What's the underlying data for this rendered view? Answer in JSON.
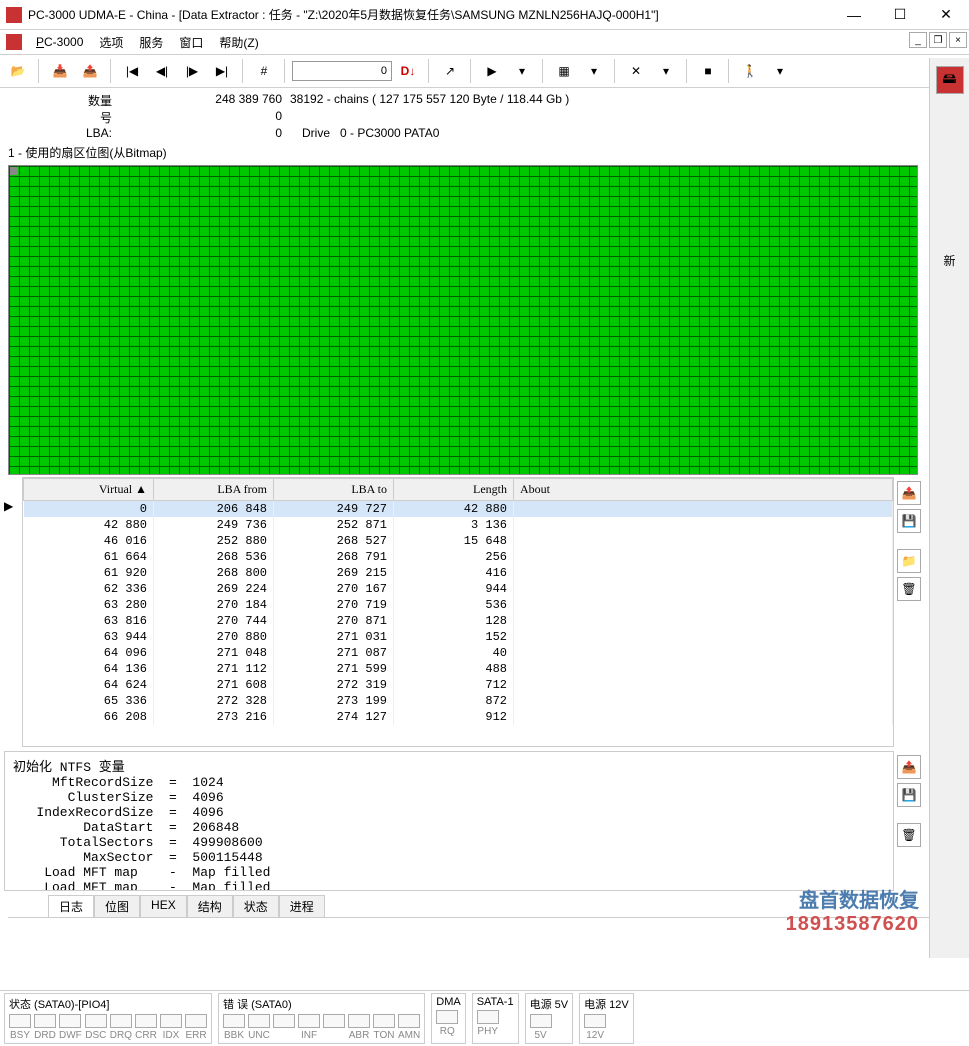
{
  "window": {
    "title": "PC-3000 UDMA-E - China - [Data Extractor : 任务 - \"Z:\\2020年5月数据恢复任务\\SAMSUNG MZNLN256HAJQ-000H1\"]"
  },
  "menu": {
    "app": "PC-3000",
    "items": [
      "选项",
      "服务",
      "窗口",
      "帮助(Z)"
    ]
  },
  "toolbar": {
    "input_value": "0",
    "input_marker": "D↓"
  },
  "info": {
    "qty_label": "数量",
    "qty_value": "248 389 760",
    "chains": "38192 - chains   ( 127 175 557 120 Byte /  118.44 Gb )",
    "num_label": "号",
    "num_value": "0",
    "lba_label": "LBA:",
    "lba_value": "0",
    "drive_label": "Drive",
    "drive_value": "0 - PC3000 PATA0"
  },
  "bitmap": {
    "title": "1 - 使用的扇区位图(从Bitmap)"
  },
  "table": {
    "headers": [
      "Virtual   ▲",
      "LBA from",
      "LBA to",
      "Length",
      "About"
    ],
    "rows": [
      {
        "virtual": "0",
        "from": "206 848",
        "to": "249 727",
        "len": "42 880",
        "sel": true
      },
      {
        "virtual": "42 880",
        "from": "249 736",
        "to": "252 871",
        "len": "3 136"
      },
      {
        "virtual": "46 016",
        "from": "252 880",
        "to": "268 527",
        "len": "15 648"
      },
      {
        "virtual": "61 664",
        "from": "268 536",
        "to": "268 791",
        "len": "256"
      },
      {
        "virtual": "61 920",
        "from": "268 800",
        "to": "269 215",
        "len": "416"
      },
      {
        "virtual": "62 336",
        "from": "269 224",
        "to": "270 167",
        "len": "944"
      },
      {
        "virtual": "63 280",
        "from": "270 184",
        "to": "270 719",
        "len": "536"
      },
      {
        "virtual": "63 816",
        "from": "270 744",
        "to": "270 871",
        "len": "128"
      },
      {
        "virtual": "63 944",
        "from": "270 880",
        "to": "271 031",
        "len": "152"
      },
      {
        "virtual": "64 096",
        "from": "271 048",
        "to": "271 087",
        "len": "40"
      },
      {
        "virtual": "64 136",
        "from": "271 112",
        "to": "271 599",
        "len": "488"
      },
      {
        "virtual": "64 624",
        "from": "271 608",
        "to": "272 319",
        "len": "712"
      },
      {
        "virtual": "65 336",
        "from": "272 328",
        "to": "273 199",
        "len": "872"
      },
      {
        "virtual": "66 208",
        "from": "273 216",
        "to": "274 127",
        "len": "912"
      }
    ]
  },
  "log": {
    "text": "初始化 NTFS 变量\n     MftRecordSize  =  1024\n       ClusterSize  =  4096\n   IndexRecordSize  =  4096\n         DataStart  =  206848\n      TotalSectors  =  499908600\n         MaxSector  =  500115448\n    Load MFT map    -  Map filled\n    Load MFT map    -  Map filled"
  },
  "tabs": {
    "items": [
      "日志",
      "位图",
      "HEX",
      "结构",
      "状态",
      "进程"
    ],
    "active": 0
  },
  "status": {
    "group1": {
      "title": "状态 (SATA0)-[PIO4]",
      "leds": [
        "BSY",
        "DRD",
        "DWF",
        "DSC",
        "DRQ",
        "CRR",
        "IDX",
        "ERR"
      ]
    },
    "group2": {
      "title": "错 误 (SATA0)",
      "leds": [
        "BBK",
        "UNC",
        "",
        "INF",
        "",
        "ABR",
        "TON",
        "AMN"
      ]
    },
    "group3": {
      "title": "DMA",
      "leds": [
        "RQ"
      ]
    },
    "group4": {
      "title": "SATA-1",
      "leds": [
        "PHY"
      ]
    },
    "group5": {
      "title": "电源 5V",
      "leds": [
        "5V"
      ]
    },
    "group6": {
      "title": "电源 12V",
      "leds": [
        "12V"
      ]
    }
  },
  "watermark": {
    "line1": "盘首数据恢复",
    "line2": "18913587620"
  },
  "sidebar_text": "新"
}
